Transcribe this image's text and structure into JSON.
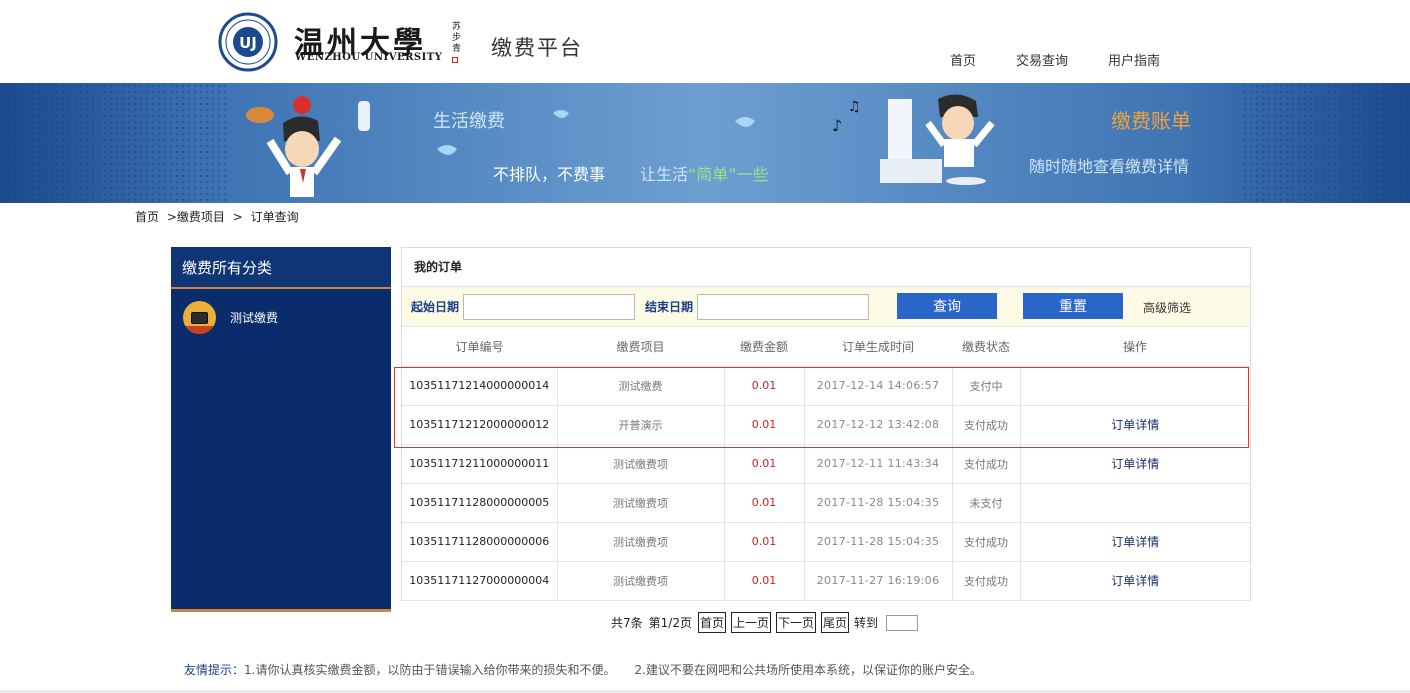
{
  "header": {
    "logo_cn": "温州大學",
    "logo_en": "WENZHOU UNIVERSITY",
    "logo_seal": "苏步青",
    "platform_name": "缴费平台",
    "nav": [
      "首页",
      "交易查询",
      "用户指南"
    ]
  },
  "banner": {
    "life_pay": "生活缴费",
    "slogan_1": "不排队，不费事",
    "slogan_2a": "让生活",
    "slogan_2b": "“简单”",
    "slogan_2c": "一些",
    "bill_title": "缴费账单",
    "bill_sub": "随时随地查看缴费详情"
  },
  "breadcrumb": [
    "首页",
    ">缴费项目",
    ">",
    "订单查询"
  ],
  "sidebar": {
    "title": "缴费所有分类",
    "items": [
      {
        "label": "测试缴费",
        "icon": "monitor-icon"
      }
    ]
  },
  "orders_panel": {
    "title": "我的订单",
    "start_label": "起始日期",
    "end_label": "结束日期",
    "start_value": "",
    "end_value": "",
    "query_btn": "查询",
    "reset_btn": "重置",
    "advanced": "高级筛选",
    "columns": [
      "订单编号",
      "缴费项目",
      "缴费金额",
      "订单生成时间",
      "缴费状态",
      "操作"
    ],
    "rows": [
      {
        "id": "10351171214000000014",
        "item": "测试缴费",
        "amount": "0.01",
        "time": "2017-12-14 14:06:57",
        "status": "支付中",
        "action": ""
      },
      {
        "id": "10351171212000000012",
        "item": "开普演示",
        "amount": "0.01",
        "time": "2017-12-12 13:42:08",
        "status": "支付成功",
        "action": "订单详情"
      },
      {
        "id": "10351171211000000011",
        "item": "测试缴费项",
        "amount": "0.01",
        "time": "2017-12-11 11:43:34",
        "status": "支付成功",
        "action": "订单详情"
      },
      {
        "id": "10351171128000000005",
        "item": "测试缴费项",
        "amount": "0.01",
        "time": "2017-11-28 15:04:35",
        "status": "未支付",
        "action": ""
      },
      {
        "id": "10351171128000000006",
        "item": "测试缴费项",
        "amount": "0.01",
        "time": "2017-11-28 15:04:35",
        "status": "支付成功",
        "action": "订单详情"
      },
      {
        "id": "10351171127000000004",
        "item": "测试缴费项",
        "amount": "0.01",
        "time": "2017-11-27 16:19:06",
        "status": "支付成功",
        "action": "订单详情"
      }
    ]
  },
  "pagination": {
    "total": "共7条",
    "page": "第1/2页",
    "first": "首页",
    "prev": "上一页",
    "next": "下一页",
    "last": "尾页",
    "goto": "转到",
    "goto_value": ""
  },
  "footer": {
    "tip_label": "友情提示：",
    "tip_1": "1.请你认真核实缴费金额，以防由于错误输入给你带来的损失和不便。",
    "tip_2": "2.建议不要在网吧和公共场所使用本系统，以保证你的账户安全。"
  },
  "colors": {
    "brand_blue": "#0a2c6c",
    "button_blue": "#2a66c8",
    "amount_red": "#d31c1c",
    "accent_gold": "#c9873a"
  }
}
